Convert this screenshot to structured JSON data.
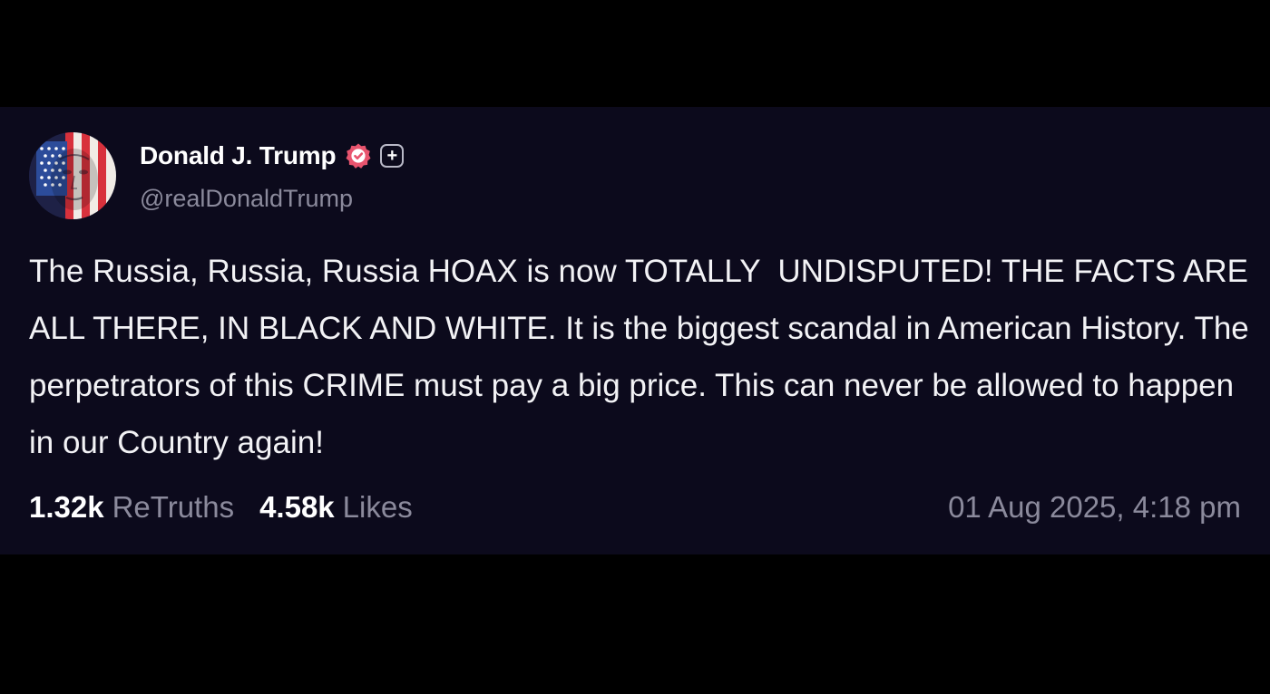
{
  "post": {
    "author": {
      "display_name": "Donald J. Trump",
      "handle": "@realDonaldTrump",
      "avatar_icon": "flag-face-avatar",
      "verified_icon": "verified-check-icon",
      "plus_icon": "plus-icon"
    },
    "text": "The Russia, Russia, Russia HOAX is now TOTALLY  UNDISPUTED! THE FACTS ARE ALL THERE, IN BLACK AND WHITE. It is the biggest scandal in American History. The perpetrators of this CRIME must pay a big price. This can never be allowed to happen in our Country again!",
    "stats": {
      "retruths_count": "1.32k",
      "retruths_label": "ReTruths",
      "likes_count": "4.58k",
      "likes_label": "Likes"
    },
    "timestamp": "01 Aug 2025, 4:18 pm"
  },
  "colors": {
    "page_background": "#000000",
    "card_background": "#0c0a1c",
    "primary_text": "#ffffff",
    "muted_text": "#8b8a9c",
    "verified_badge": "#e8546e"
  }
}
